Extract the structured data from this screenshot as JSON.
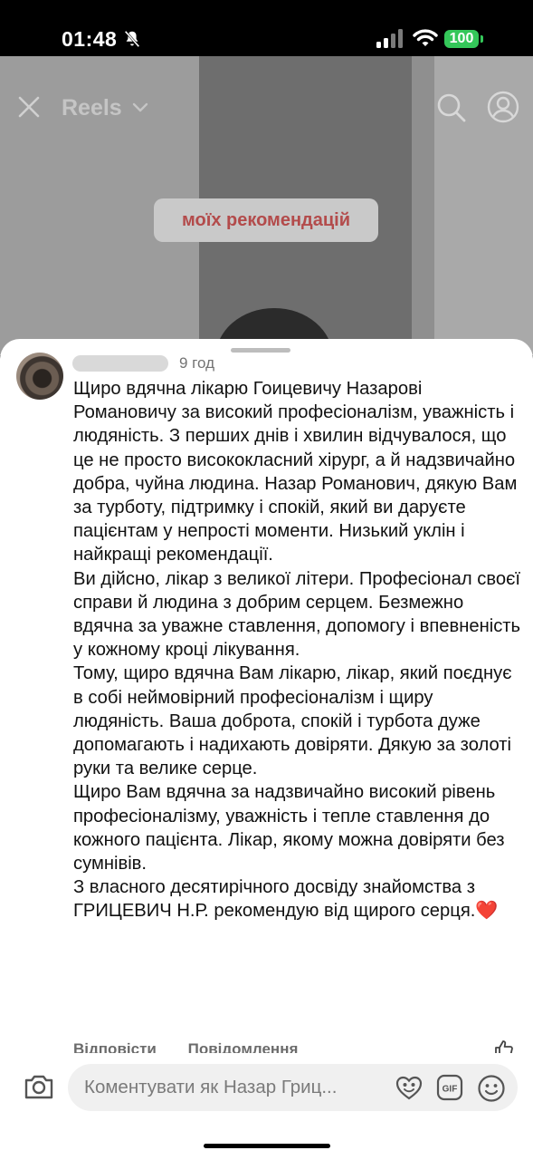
{
  "status_bar": {
    "time": "01:48",
    "battery": "100",
    "battery_color": "#34c759"
  },
  "video": {
    "title": "Reels",
    "caption": "моїх рекомендацій",
    "caption_color": "#b34b4b"
  },
  "comment": {
    "time_ago": "9 год",
    "text": "Щиро вдячна лікарю Гоицевичу Назарові Романовичу за високий професіоналізм, уважність і людяність. З перших днів і хвилин відчувалося, що це не просто висококласний хірург, а й надзвичайно добра, чуйна людина. Назар Романович, дякую Вам за турботу, підтримку і спокій, який ви даруєте пацієнтам у непрості моменти. Низький уклін і найкращі рекомендації.\nВи дійсно, лікар з великої літери. Професіонал своєї справи й людина з добрим серцем. Безмежно вдячна за уважне ставлення, допомогу і впевненість у кожному кроці лікування.\nТому, щиро вдячна Вам лікарю, лікар, який поєднує в собі неймовірний професіоналізм і щиру людяність. Ваша доброта, спокій і турбота дуже допомагають і надихають довіряти. Дякую за золоті руки та велике серце.\nЩиро Вам вдячна за надзвичайно високий рівень професіоналізму, уважність і тепле ставлення до кожного пацієнта. Лікар, якому можна довіряти без сумнівів.\nЗ власного десятирічного досвіду знайомства з ГРИЦЕВИЧ Н.Р. рекомендую від щирого серця.❤️",
    "reply_label": "Відповісти",
    "message_label": "Повідомлення"
  },
  "input": {
    "placeholder": "Коментувати як Назар Гриц..."
  },
  "icons": [
    "silent-bell-icon",
    "signal-icon",
    "wifi-icon",
    "close-icon",
    "chevron-down-icon",
    "search-icon",
    "profile-icon",
    "like-icon",
    "camera-icon",
    "mood-icon",
    "gif-icon",
    "emoji-icon"
  ]
}
